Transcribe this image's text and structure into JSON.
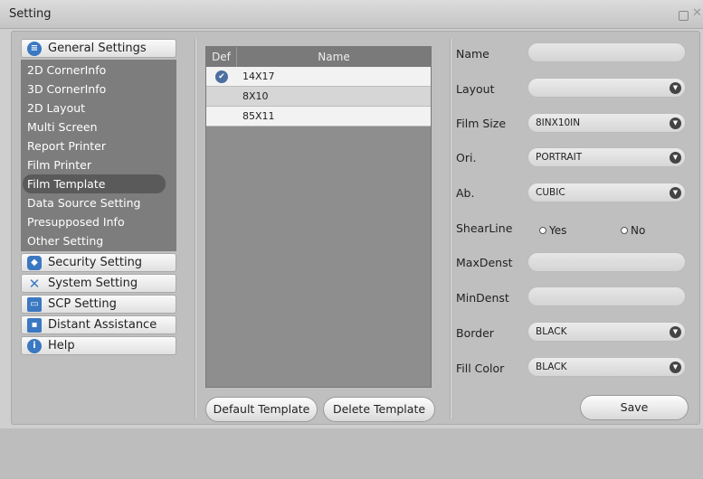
{
  "window": {
    "title": "Setting"
  },
  "nav": {
    "groups": [
      {
        "label": "General Settings",
        "icon": "list-icon",
        "color": "#3b78c2"
      },
      {
        "label": "Security Setting",
        "icon": "shield-icon",
        "color": "#3b78c2"
      },
      {
        "label": "System Setting",
        "icon": "tools-icon",
        "color": "#3b78c2"
      },
      {
        "label": "SCP Setting",
        "icon": "monitor-icon",
        "color": "#3b78c2"
      },
      {
        "label": "Distant Assistance",
        "icon": "network-icon",
        "color": "#3b78c2"
      },
      {
        "label": "Help",
        "icon": "info-icon",
        "color": "#3b78c2"
      }
    ],
    "general_items": [
      "2D CornerInfo",
      "3D CornerInfo",
      "2D Layout",
      "Multi Screen",
      "Report Printer",
      "Film Printer",
      "Film Template",
      "Data Source Setting",
      "Presupposed Info",
      "Other Setting"
    ],
    "selected_item": "Film Template"
  },
  "templates": {
    "columns": {
      "def": "Def",
      "name": "Name"
    },
    "rows": [
      {
        "name": "14X17",
        "default": true
      },
      {
        "name": "8X10",
        "default": false
      },
      {
        "name": "85X11",
        "default": false
      }
    ],
    "default_button": "Default Template",
    "delete_button": "Delete Template"
  },
  "form": {
    "name_label": "Name",
    "name_value": "",
    "layout_label": "Layout",
    "layout_value": "",
    "film_size_label": "Film Size",
    "film_size_value": "8INX10IN",
    "ori_label": "Ori.",
    "ori_value": "PORTRAIT",
    "ab_label": "Ab.",
    "ab_value": "CUBIC",
    "shearline_label": "ShearLine",
    "shearline_yes": "Yes",
    "shearline_no": "No",
    "maxdenst_label": "MaxDenst",
    "maxdenst_value": "",
    "mindenst_label": "MinDenst",
    "mindenst_value": "",
    "border_label": "Border",
    "border_value": "BLACK",
    "fill_color_label": "Fill Color",
    "fill_color_value": "BLACK",
    "save_button": "Save"
  }
}
